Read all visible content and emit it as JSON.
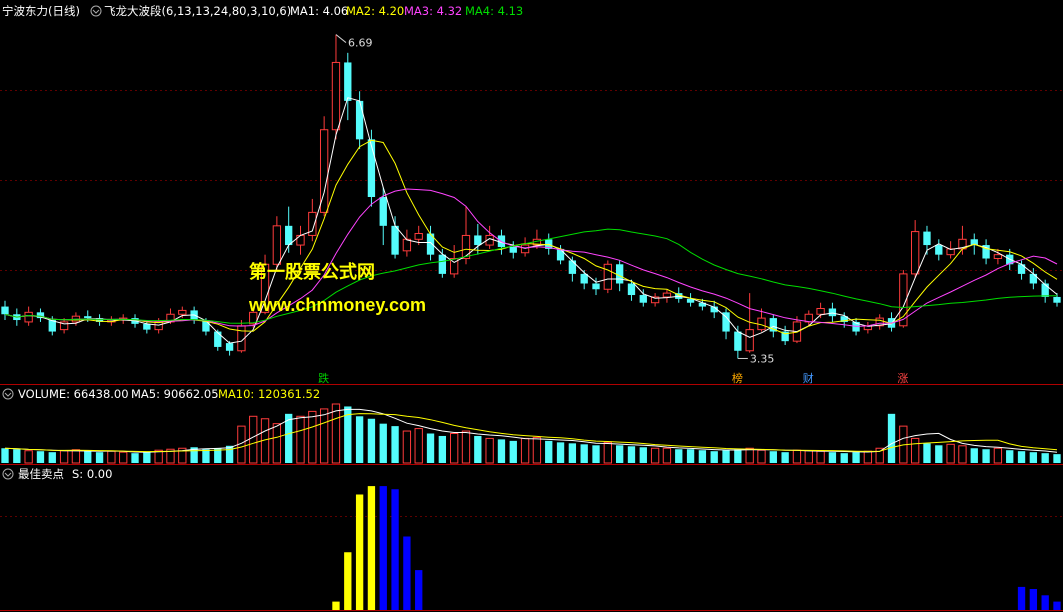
{
  "panes": {
    "main": {
      "stock_name": "宁波东力(日线)",
      "indicator_name": "飞龙大波段(6,13,13,24,80,3,10,6)",
      "ma_labels": [
        {
          "text": "MA1: 4.06",
          "color": "#ffffff"
        },
        {
          "text": "MA2: 4.20",
          "color": "#ffff00"
        },
        {
          "text": "MA3: 4.32",
          "color": "#ff44ff"
        },
        {
          "text": "MA4: 4.13",
          "color": "#00ff00"
        }
      ],
      "high_label": "6.69",
      "low_label": "3.35",
      "events": [
        {
          "text": "跌",
          "color": "#00cc00",
          "at": 27
        },
        {
          "text": "榜",
          "color": "#ffaa00",
          "at": 62
        },
        {
          "text": "财",
          "color": "#4499ff",
          "at": 68
        },
        {
          "text": "涨",
          "color": "#ff4444",
          "at": 76
        }
      ]
    },
    "volume": {
      "label": "VOLUME: 66438.00",
      "ma5": "MA5: 90662.05",
      "ma10": "MA10: 120361.52"
    },
    "signal": {
      "label": "最佳卖点",
      "value": "S: 0.00"
    }
  },
  "watermark": {
    "line1": "第一股票公式网",
    "line2": "www.chnmoney.com"
  },
  "colors": {
    "up": "#ff3c3c",
    "down": "#54fcfc",
    "ma1": "#ffffff",
    "ma2": "#ffff00",
    "ma3": "#ff44ff",
    "ma4": "#00dd00",
    "border": "#b00000",
    "signal_up": "#ffff00",
    "signal_down": "#0000ff"
  },
  "chart_data": {
    "type": "candlestick",
    "price_range": [
      3.2,
      6.8
    ],
    "candles": [
      [
        3.86,
        3.78,
        3.92,
        3.72
      ],
      [
        3.78,
        3.72,
        3.84,
        3.66
      ],
      [
        3.7,
        3.8,
        3.86,
        3.66
      ],
      [
        3.8,
        3.74,
        3.84,
        3.7
      ],
      [
        3.72,
        3.6,
        3.76,
        3.56
      ],
      [
        3.62,
        3.7,
        3.74,
        3.58
      ],
      [
        3.7,
        3.76,
        3.8,
        3.66
      ],
      [
        3.76,
        3.74,
        3.82,
        3.7
      ],
      [
        3.74,
        3.7,
        3.78,
        3.66
      ],
      [
        3.7,
        3.72,
        3.76,
        3.66
      ],
      [
        3.72,
        3.74,
        3.78,
        3.68
      ],
      [
        3.74,
        3.68,
        3.78,
        3.64
      ],
      [
        3.68,
        3.62,
        3.72,
        3.58
      ],
      [
        3.62,
        3.7,
        3.74,
        3.58
      ],
      [
        3.7,
        3.78,
        3.84,
        3.68
      ],
      [
        3.78,
        3.82,
        3.86,
        3.74
      ],
      [
        3.82,
        3.72,
        3.86,
        3.68
      ],
      [
        3.72,
        3.6,
        3.74,
        3.56
      ],
      [
        3.6,
        3.44,
        3.62,
        3.4
      ],
      [
        3.48,
        3.4,
        3.5,
        3.35
      ],
      [
        3.4,
        3.66,
        3.72,
        3.38
      ],
      [
        3.68,
        3.8,
        3.84,
        3.64
      ],
      [
        3.8,
        4.3,
        4.4,
        3.78
      ],
      [
        4.3,
        4.7,
        4.8,
        4.24
      ],
      [
        4.7,
        4.5,
        4.9,
        4.42
      ],
      [
        4.5,
        4.6,
        4.7,
        4.4
      ],
      [
        4.6,
        4.84,
        4.98,
        4.54
      ],
      [
        4.84,
        5.7,
        5.84,
        4.8
      ],
      [
        5.7,
        6.4,
        6.69,
        5.6
      ],
      [
        6.4,
        6.0,
        6.5,
        5.8
      ],
      [
        6.0,
        5.6,
        6.1,
        5.5
      ],
      [
        5.6,
        5.0,
        5.7,
        4.9
      ],
      [
        5.0,
        4.7,
        5.1,
        4.5
      ],
      [
        4.7,
        4.4,
        4.8,
        4.36
      ],
      [
        4.44,
        4.56,
        4.66,
        4.38
      ],
      [
        4.56,
        4.62,
        4.7,
        4.5
      ],
      [
        4.62,
        4.4,
        4.7,
        4.34
      ],
      [
        4.4,
        4.2,
        4.46,
        4.16
      ],
      [
        4.2,
        4.36,
        4.5,
        4.16
      ],
      [
        4.36,
        4.6,
        4.9,
        4.3
      ],
      [
        4.6,
        4.5,
        4.72,
        4.4
      ],
      [
        4.5,
        4.6,
        4.7,
        4.46
      ],
      [
        4.6,
        4.48,
        4.66,
        4.4
      ],
      [
        4.48,
        4.42,
        4.54,
        4.36
      ],
      [
        4.42,
        4.5,
        4.58,
        4.38
      ],
      [
        4.5,
        4.56,
        4.66,
        4.46
      ],
      [
        4.56,
        4.46,
        4.62,
        4.4
      ],
      [
        4.46,
        4.34,
        4.5,
        4.3
      ],
      [
        4.34,
        4.2,
        4.38,
        4.12
      ],
      [
        4.2,
        4.1,
        4.24,
        4.04
      ],
      [
        4.1,
        4.04,
        4.16,
        3.98
      ],
      [
        4.04,
        4.3,
        4.34,
        4.0
      ],
      [
        4.3,
        4.1,
        4.34,
        4.02
      ],
      [
        4.1,
        3.98,
        4.14,
        3.92
      ],
      [
        3.98,
        3.9,
        4.04,
        3.86
      ],
      [
        3.9,
        3.96,
        4.0,
        3.86
      ],
      [
        3.96,
        4.0,
        4.04,
        3.9
      ],
      [
        4.0,
        3.94,
        4.06,
        3.9
      ],
      [
        3.94,
        3.9,
        4.0,
        3.86
      ],
      [
        3.9,
        3.86,
        3.94,
        3.82
      ],
      [
        3.86,
        3.8,
        3.92,
        3.74
      ],
      [
        3.8,
        3.6,
        3.84,
        3.52
      ],
      [
        3.6,
        3.4,
        3.66,
        3.32
      ],
      [
        3.4,
        3.62,
        4.0,
        3.38
      ],
      [
        3.62,
        3.74,
        3.84,
        3.6
      ],
      [
        3.74,
        3.6,
        3.78,
        3.54
      ],
      [
        3.6,
        3.5,
        3.66,
        3.46
      ],
      [
        3.5,
        3.7,
        3.76,
        3.48
      ],
      [
        3.7,
        3.78,
        3.82,
        3.66
      ],
      [
        3.78,
        3.84,
        3.9,
        3.74
      ],
      [
        3.84,
        3.76,
        3.9,
        3.7
      ],
      [
        3.76,
        3.7,
        3.8,
        3.64
      ],
      [
        3.7,
        3.6,
        3.74,
        3.56
      ],
      [
        3.62,
        3.66,
        3.7,
        3.58
      ],
      [
        3.66,
        3.74,
        3.78,
        3.62
      ],
      [
        3.74,
        3.64,
        3.8,
        3.6
      ],
      [
        3.66,
        4.2,
        4.24,
        3.64
      ],
      [
        4.2,
        4.64,
        4.76,
        4.16
      ],
      [
        4.64,
        4.5,
        4.7,
        4.4
      ],
      [
        4.5,
        4.4,
        4.56,
        4.34
      ],
      [
        4.4,
        4.46,
        4.54,
        4.36
      ],
      [
        4.46,
        4.56,
        4.7,
        4.4
      ],
      [
        4.56,
        4.5,
        4.62,
        4.4
      ],
      [
        4.5,
        4.36,
        4.56,
        4.3
      ],
      [
        4.36,
        4.4,
        4.46,
        4.3
      ],
      [
        4.4,
        4.3,
        4.46,
        4.24
      ],
      [
        4.3,
        4.2,
        4.34,
        4.14
      ],
      [
        4.2,
        4.1,
        4.26,
        4.04
      ],
      [
        4.1,
        3.96,
        4.14,
        3.9
      ],
      [
        3.96,
        3.9,
        4.0,
        3.86
      ]
    ],
    "volume": [
      30,
      28,
      25,
      24,
      22,
      25,
      27,
      24,
      22,
      24,
      22,
      20,
      22,
      26,
      28,
      30,
      32,
      28,
      30,
      35,
      75,
      95,
      90,
      80,
      100,
      95,
      105,
      110,
      120,
      115,
      95,
      90,
      80,
      75,
      65,
      70,
      60,
      55,
      60,
      65,
      55,
      50,
      48,
      45,
      50,
      52,
      45,
      42,
      40,
      38,
      36,
      42,
      36,
      34,
      32,
      30,
      30,
      28,
      28,
      26,
      24,
      26,
      28,
      30,
      26,
      24,
      22,
      26,
      25,
      24,
      22,
      20,
      22,
      24,
      30,
      100,
      75,
      50,
      40,
      36,
      38,
      35,
      30,
      28,
      30,
      26,
      24,
      22,
      20,
      18
    ],
    "signal": [
      0,
      0,
      0,
      0,
      0,
      0,
      0,
      0,
      0,
      0,
      0,
      0,
      0,
      0,
      0,
      0,
      0,
      0,
      0,
      0,
      0,
      0,
      0,
      0,
      0,
      0,
      0,
      0,
      8,
      55,
      110,
      118,
      118,
      115,
      70,
      38,
      0,
      0,
      0,
      0,
      0,
      0,
      0,
      0,
      0,
      0,
      0,
      0,
      0,
      0,
      0,
      0,
      0,
      0,
      0,
      0,
      0,
      0,
      0,
      0,
      0,
      0,
      0,
      0,
      0,
      0,
      0,
      0,
      0,
      0,
      0,
      0,
      0,
      0,
      0,
      0,
      0,
      0,
      0,
      0,
      0,
      0,
      0,
      0,
      0,
      0,
      22,
      20,
      14,
      8
    ],
    "signal_rising_until": 31
  }
}
